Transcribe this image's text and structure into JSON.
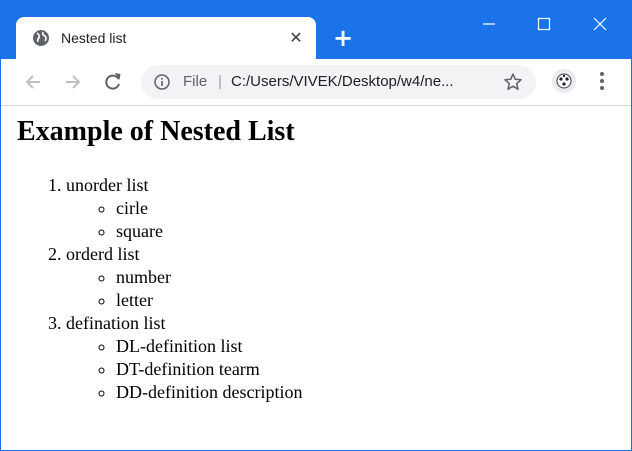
{
  "browser": {
    "tab_title": "Nested list",
    "tab_close": "✕",
    "new_tab": "+",
    "address_scheme_label": "File",
    "address_separator": "|",
    "url": "C:/Users/VIVEK/Desktop/w4/ne..."
  },
  "page": {
    "heading": "Example of Nested List",
    "list": [
      {
        "label": "unorder list",
        "children": [
          "cirle",
          "square"
        ]
      },
      {
        "label": "orderd list",
        "children": [
          "number",
          "letter"
        ]
      },
      {
        "label": "defination list",
        "children": [
          "DL-definition list",
          "DT-definition tearm",
          "DD-definition description"
        ]
      }
    ]
  },
  "colors": {
    "titlebar": "#1a73e8",
    "omnibox": "#f1f3f4"
  },
  "icons": [
    "globe-icon",
    "close-icon",
    "new-tab-icon",
    "minimize-icon",
    "maximize-icon",
    "window-close-icon",
    "back-icon",
    "forward-icon",
    "reload-icon",
    "info-icon",
    "star-icon",
    "profile-icon",
    "menu-icon"
  ]
}
